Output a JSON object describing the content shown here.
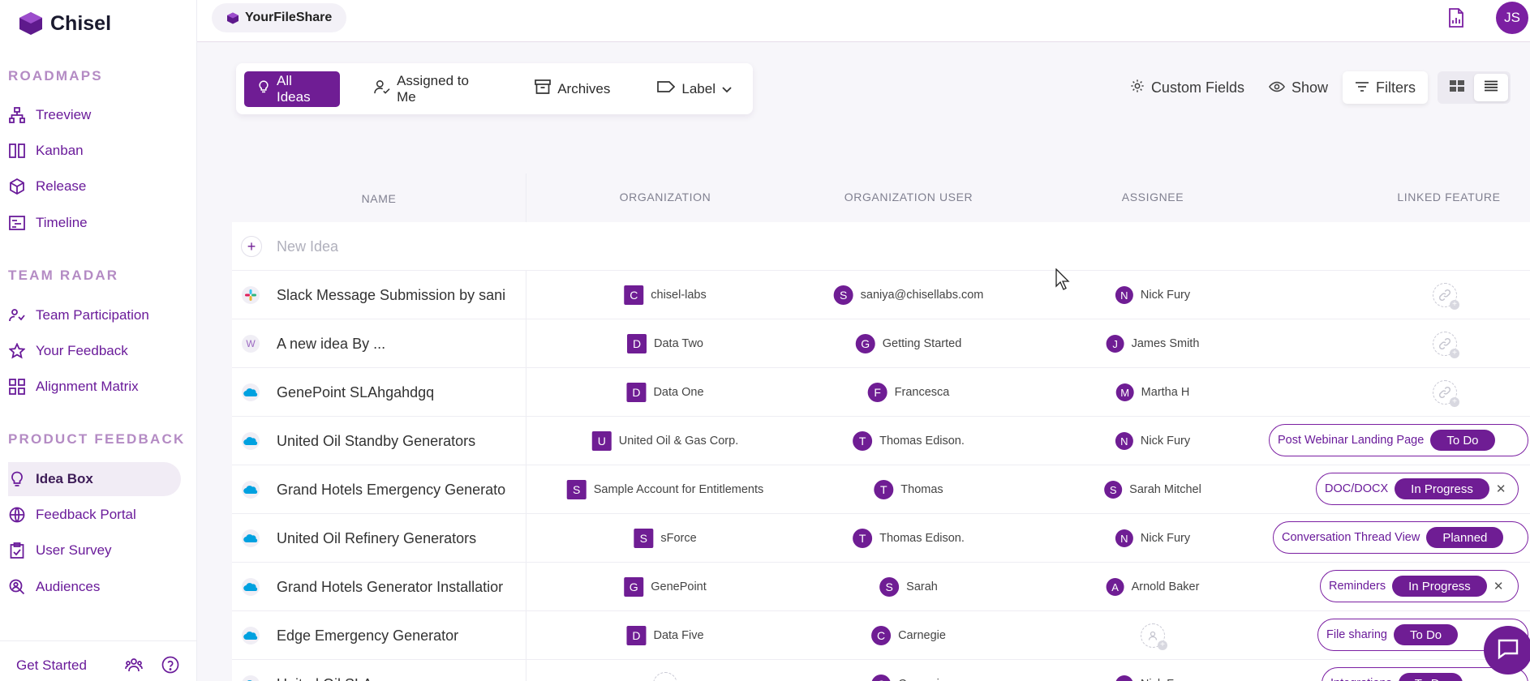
{
  "app": {
    "name": "Chisel",
    "workspace": "YourFileShare",
    "user_initials": "JS"
  },
  "sidebar": {
    "sections": [
      {
        "title": "ROADMAPS",
        "items": [
          {
            "label": "Treeview",
            "icon": "treeview-icon"
          },
          {
            "label": "Kanban",
            "icon": "kanban-icon"
          },
          {
            "label": "Release",
            "icon": "release-icon"
          },
          {
            "label": "Timeline",
            "icon": "timeline-icon"
          }
        ]
      },
      {
        "title": "TEAM RADAR",
        "items": [
          {
            "label": "Team Participation",
            "icon": "team-participation-icon"
          },
          {
            "label": "Your Feedback",
            "icon": "star-icon"
          },
          {
            "label": "Alignment Matrix",
            "icon": "grid-icon"
          }
        ]
      },
      {
        "title": "PRODUCT FEEDBACK",
        "items": [
          {
            "label": "Idea Box",
            "icon": "lightbulb-icon",
            "active": true
          },
          {
            "label": "Feedback Portal",
            "icon": "globe-icon"
          },
          {
            "label": "User Survey",
            "icon": "clipboard-icon"
          },
          {
            "label": "Audiences",
            "icon": "search-person-icon"
          }
        ]
      }
    ],
    "footer": {
      "get_started": "Get Started"
    }
  },
  "tabs": [
    {
      "label": "All Ideas",
      "active": true
    },
    {
      "label": "Assigned to Me"
    },
    {
      "label": "Archives"
    },
    {
      "label": "Label"
    }
  ],
  "tools": {
    "custom_fields": "Custom Fields",
    "show": "Show",
    "filters": "Filters"
  },
  "table": {
    "columns": [
      "NAME",
      "ORGANIZATION",
      "ORGANIZATION USER",
      "ASSIGNEE",
      "LINKED FEATURE"
    ],
    "new_idea_placeholder": "New Idea",
    "rows": [
      {
        "source": "slack",
        "name": "Slack Message Submission by sani",
        "org": "chisel-labs",
        "org_init": "C",
        "org_user": "saniya@chisellabs.com",
        "org_user_init": "S",
        "assignee": "Nick Fury",
        "assignee_init": "N",
        "feature": null
      },
      {
        "source": "web",
        "source_letter": "W",
        "name": "A new idea By ...",
        "org": "Data Two",
        "org_init": "D",
        "org_user": "Getting Started",
        "org_user_init": "G",
        "assignee": "James Smith",
        "assignee_init": "J",
        "feature": null
      },
      {
        "source": "salesforce",
        "name": "GenePoint SLAhgahdgq",
        "org": "Data One",
        "org_init": "D",
        "org_user": "Francesca",
        "org_user_init": "F",
        "assignee": "Martha H",
        "assignee_init": "M",
        "feature": null
      },
      {
        "source": "salesforce",
        "name": "United Oil Standby Generators",
        "org": "United Oil & Gas Corp.",
        "org_init": "U",
        "org_user": "Thomas Edison.",
        "org_user_init": "T",
        "assignee": "Nick Fury",
        "assignee_init": "N",
        "feature": {
          "name": "Post Webinar Landing Page",
          "status": "To Do",
          "removable": false
        }
      },
      {
        "source": "salesforce",
        "name": "Grand Hotels Emergency Generato",
        "org": "Sample Account for Entitlements",
        "org_init": "S",
        "org_user": "Thomas",
        "org_user_init": "T",
        "assignee": "Sarah Mitchel",
        "assignee_init": "S",
        "feature": {
          "name": "DOC/DOCX",
          "status": "In Progress",
          "removable": true
        }
      },
      {
        "source": "salesforce",
        "name": "United Oil Refinery Generators",
        "org": "sForce",
        "org_init": "S",
        "org_user": "Thomas Edison.",
        "org_user_init": "T",
        "assignee": "Nick Fury",
        "assignee_init": "N",
        "feature": {
          "name": "Conversation Thread View",
          "status": "Planned",
          "removable": false
        }
      },
      {
        "source": "salesforce",
        "name": "Grand Hotels Generator Installatior",
        "org": "GenePoint",
        "org_init": "G",
        "org_user": "Sarah",
        "org_user_init": "S",
        "assignee": "Arnold Baker",
        "assignee_init": "A",
        "feature": {
          "name": "Reminders",
          "status": "In Progress",
          "removable": true
        }
      },
      {
        "source": "salesforce",
        "name": "Edge Emergency Generator",
        "org": "Data Five",
        "org_init": "D",
        "org_user": "Carnegie",
        "org_user_init": "C",
        "assignee": null,
        "feature": {
          "name": "File sharing",
          "status": "To Do",
          "removable": false
        }
      },
      {
        "source": "salesforce",
        "name": "United Oil SLA",
        "org": null,
        "org_user": "Carnegie",
        "org_user_init": "C",
        "assignee": "Nick Fury",
        "assignee_init": "N",
        "feature": {
          "name": "Integrations",
          "status": "To Do",
          "removable": false
        }
      }
    ]
  },
  "colors": {
    "accent": "#6f1d94",
    "sidebar_text": "#6a1b9a",
    "section_title": "#b48bc4"
  }
}
